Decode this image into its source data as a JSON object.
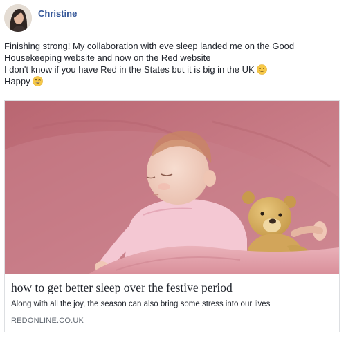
{
  "post": {
    "author": "Christine",
    "lines": [
      "Finishing strong! My collaboration with eve sleep landed me on the Good",
      "Housekeeping website and now on the Red website",
      "I don't know if you have Red in the States but it is big in the UK",
      "Happy"
    ],
    "emoji_line3": "slightly-smiling-face-icon",
    "emoji_line4": "grinning-face-icon"
  },
  "link_preview": {
    "image": "baby-sleeping-with-teddy-bear",
    "title": "how to get better sleep over the festive period",
    "description": "Along with all the joy, the season can also bring some stress into our lives",
    "domain": "REDONLINE.CO.UK"
  },
  "colors": {
    "author_link": "#365899",
    "text": "#1d2129",
    "domain": "#606770",
    "blanket_pink": "#e7a2ad"
  }
}
